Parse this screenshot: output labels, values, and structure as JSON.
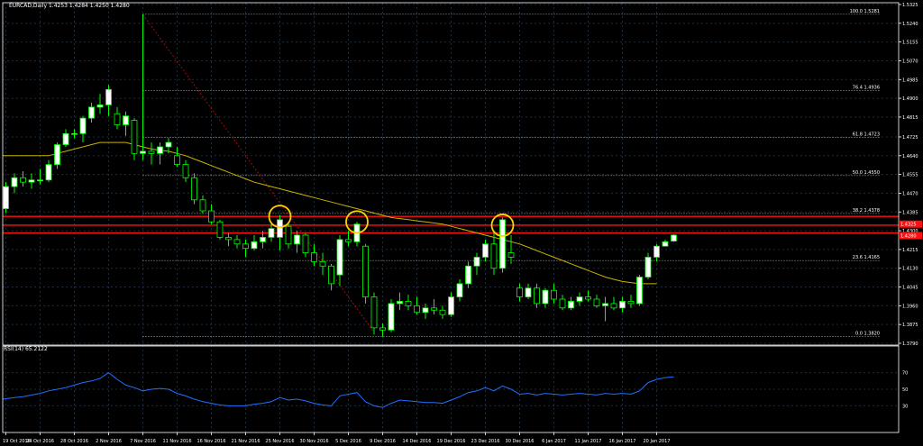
{
  "header": {
    "symbol_line": "EURCAD,Daily  1.4253 1.4284 1.4250 1.4280"
  },
  "rsi_label": "RSI(14) 65.2122",
  "colors": {
    "background": "#000000",
    "frame": "#ffffff",
    "grid": "#1e2c3a",
    "bull": "#00ff00",
    "bull_body": "#ffffff",
    "bear": "#00ff00",
    "bear_body": "#000000",
    "ma": "#c8b400",
    "fib": "#ffffff",
    "resistance": "#ff1010",
    "trend": "#c01010",
    "circle": "#ffd400",
    "rsi": "#2070ff",
    "price_tag": "#ff1010"
  },
  "chart_data": [
    {
      "type": "candlestick",
      "title": "EURCAD,Daily",
      "ylim": [
        1.379,
        1.5325
      ],
      "y_ticks": [
        "1.5325",
        "1.5240",
        "1.5155",
        "1.5070",
        "1.4985",
        "1.4900",
        "1.4815",
        "1.4725",
        "1.4640",
        "1.4555",
        "1.4470",
        "1.4385",
        "1.4300",
        "1.4215",
        "1.4130",
        "1.4045",
        "1.3960",
        "1.3875",
        "1.3790"
      ],
      "x_ticks": [
        {
          "i": 0,
          "label": "19 Oct 2016"
        },
        {
          "i": 4,
          "label": "24 Oct 2016"
        },
        {
          "i": 8,
          "label": "28 Oct 2016"
        },
        {
          "i": 12,
          "label": "2 Nov 2016"
        },
        {
          "i": 16,
          "label": "7 Nov 2016"
        },
        {
          "i": 20,
          "label": "11 Nov 2016"
        },
        {
          "i": 24,
          "label": "16 Nov 2016"
        },
        {
          "i": 28,
          "label": "21 Nov 2016"
        },
        {
          "i": 32,
          "label": "25 Nov 2016"
        },
        {
          "i": 36,
          "label": "30 Nov 2016"
        },
        {
          "i": 40,
          "label": "5 Dec 2016"
        },
        {
          "i": 44,
          "label": "9 Dec 2016"
        },
        {
          "i": 48,
          "label": "14 Dec 2016"
        },
        {
          "i": 52,
          "label": "19 Dec 2016"
        },
        {
          "i": 56,
          "label": "23 Dec 2016"
        },
        {
          "i": 60,
          "label": "30 Dec 2016"
        },
        {
          "i": 64,
          "label": "6 Jan 2017"
        },
        {
          "i": 68,
          "label": "11 Jan 2017"
        },
        {
          "i": 72,
          "label": "16 Jan 2017"
        },
        {
          "i": 76,
          "label": "20 Jan 2017"
        }
      ],
      "candles": [
        [
          1.44,
          1.452,
          1.438,
          1.45
        ],
        [
          1.45,
          1.456,
          1.447,
          1.454
        ],
        [
          1.454,
          1.457,
          1.45,
          1.452
        ],
        [
          1.452,
          1.456,
          1.449,
          1.453
        ],
        [
          1.453,
          1.458,
          1.451,
          1.453
        ],
        [
          1.453,
          1.462,
          1.452,
          1.46
        ],
        [
          1.46,
          1.47,
          1.458,
          1.469
        ],
        [
          1.469,
          1.476,
          1.468,
          1.474
        ],
        [
          1.474,
          1.476,
          1.472,
          1.474
        ],
        [
          1.474,
          1.482,
          1.47,
          1.481
        ],
        [
          1.481,
          1.488,
          1.479,
          1.486
        ],
        [
          1.486,
          1.492,
          1.483,
          1.487
        ],
        [
          1.487,
          1.496,
          1.482,
          1.494
        ],
        [
          1.483,
          1.486,
          1.476,
          1.478
        ],
        [
          1.478,
          1.484,
          1.473,
          1.482
        ],
        [
          1.48,
          1.481,
          1.462,
          1.465
        ],
        [
          1.465,
          1.528,
          1.462,
          1.466
        ],
        [
          1.466,
          1.47,
          1.46,
          1.465
        ],
        [
          1.465,
          1.47,
          1.46,
          1.468
        ],
        [
          1.468,
          1.472,
          1.465,
          1.47
        ],
        [
          1.464,
          1.468,
          1.459,
          1.46
        ],
        [
          1.46,
          1.462,
          1.452,
          1.454
        ],
        [
          1.454,
          1.456,
          1.442,
          1.444
        ],
        [
          1.444,
          1.446,
          1.438,
          1.439
        ],
        [
          1.439,
          1.442,
          1.433,
          1.434
        ],
        [
          1.434,
          1.435,
          1.426,
          1.427
        ],
        [
          1.427,
          1.429,
          1.423,
          1.426
        ],
        [
          1.426,
          1.428,
          1.422,
          1.424
        ],
        [
          1.424,
          1.426,
          1.418,
          1.422
        ],
        [
          1.422,
          1.428,
          1.421,
          1.425
        ],
        [
          1.425,
          1.43,
          1.422,
          1.427
        ],
        [
          1.427,
          1.433,
          1.425,
          1.431
        ],
        [
          1.427,
          1.437,
          1.421,
          1.435
        ],
        [
          1.432,
          1.434,
          1.422,
          1.424
        ],
        [
          1.424,
          1.43,
          1.42,
          1.428
        ],
        [
          1.428,
          1.429,
          1.418,
          1.42
        ],
        [
          1.42,
          1.424,
          1.414,
          1.416
        ],
        [
          1.416,
          1.42,
          1.41,
          1.414
        ],
        [
          1.414,
          1.415,
          1.403,
          1.406
        ],
        [
          1.41,
          1.428,
          1.405,
          1.426
        ],
        [
          1.426,
          1.43,
          1.423,
          1.425
        ],
        [
          1.425,
          1.434,
          1.423,
          1.433
        ],
        [
          1.423,
          1.424,
          1.397,
          1.4
        ],
        [
          1.4,
          1.402,
          1.383,
          1.386
        ],
        [
          1.386,
          1.388,
          1.382,
          1.385
        ],
        [
          1.385,
          1.399,
          1.384,
          1.397
        ],
        [
          1.397,
          1.402,
          1.394,
          1.398
        ],
        [
          1.398,
          1.401,
          1.394,
          1.396
        ],
        [
          1.396,
          1.4,
          1.392,
          1.393
        ],
        [
          1.393,
          1.397,
          1.39,
          1.395
        ],
        [
          1.395,
          1.399,
          1.392,
          1.394
        ],
        [
          1.394,
          1.396,
          1.39,
          1.392
        ],
        [
          1.392,
          1.402,
          1.391,
          1.4
        ],
        [
          1.4,
          1.408,
          1.398,
          1.406
        ],
        [
          1.406,
          1.416,
          1.404,
          1.414
        ],
        [
          1.414,
          1.42,
          1.41,
          1.418
        ],
        [
          1.418,
          1.426,
          1.416,
          1.424
        ],
        [
          1.424,
          1.43,
          1.41,
          1.413
        ],
        [
          1.413,
          1.436,
          1.411,
          1.435
        ],
        [
          1.42,
          1.428,
          1.415,
          1.418
        ],
        [
          1.404,
          1.406,
          1.398,
          1.4
        ],
        [
          1.4,
          1.406,
          1.399,
          1.404
        ],
        [
          1.404,
          1.406,
          1.395,
          1.397
        ],
        [
          1.397,
          1.404,
          1.395,
          1.403
        ],
        [
          1.403,
          1.406,
          1.397,
          1.399
        ],
        [
          1.399,
          1.401,
          1.394,
          1.395
        ],
        [
          1.395,
          1.4,
          1.394,
          1.398
        ],
        [
          1.398,
          1.402,
          1.396,
          1.4
        ],
        [
          1.4,
          1.403,
          1.398,
          1.399
        ],
        [
          1.399,
          1.401,
          1.395,
          1.396
        ],
        [
          1.396,
          1.4,
          1.389,
          1.397
        ],
        [
          1.397,
          1.4,
          1.394,
          1.395
        ],
        [
          1.395,
          1.4,
          1.393,
          1.398
        ],
        [
          1.398,
          1.401,
          1.395,
          1.397
        ],
        [
          1.397,
          1.41,
          1.396,
          1.409
        ],
        [
          1.409,
          1.42,
          1.408,
          1.418
        ],
        [
          1.418,
          1.424,
          1.416,
          1.423
        ],
        [
          1.423,
          1.426,
          1.423,
          1.425
        ],
        [
          1.4253,
          1.4284,
          1.425,
          1.428
        ]
      ],
      "ma_values": [
        1.464,
        1.464,
        1.464,
        1.464,
        1.464,
        1.464,
        1.465,
        1.466,
        1.467,
        1.468,
        1.469,
        1.47,
        1.47,
        1.47,
        1.47,
        1.469,
        1.468,
        1.467,
        1.4665,
        1.466,
        1.465,
        1.464,
        1.4625,
        1.461,
        1.4595,
        1.458,
        1.4565,
        1.455,
        1.4535,
        1.452,
        1.451,
        1.45,
        1.449,
        1.448,
        1.447,
        1.446,
        1.445,
        1.444,
        1.443,
        1.442,
        1.441,
        1.44,
        1.439,
        1.438,
        1.437,
        1.436,
        1.4355,
        1.435,
        1.4345,
        1.434,
        1.4335,
        1.433,
        1.432,
        1.431,
        1.43,
        1.429,
        1.428,
        1.427,
        1.426,
        1.425,
        1.424,
        1.4225,
        1.421,
        1.4195,
        1.418,
        1.4165,
        1.415,
        1.4135,
        1.412,
        1.4105,
        1.409,
        1.408,
        1.407,
        1.4065,
        1.406,
        1.406,
        1.406
      ],
      "fibonacci": [
        {
          "label": "100.0  1.5281",
          "value": 1.5281
        },
        {
          "label": "76.4  1.4936",
          "value": 1.4936
        },
        {
          "label": "61.8  1.4723",
          "value": 1.4723
        },
        {
          "label": "50.0  1.4550",
          "value": 1.455
        },
        {
          "label": "38.2  1.4378",
          "value": 1.4378
        },
        {
          "label": "23.6  1.4165",
          "value": 1.4165
        },
        {
          "label": "0.0  1.3820",
          "value": 1.382
        }
      ],
      "resistance_lines": [
        1.4365,
        1.4325,
        1.429
      ],
      "price_tags": [
        {
          "label": "1.4325",
          "value": 1.433
        },
        {
          "label": "1.4280",
          "value": 1.4278
        }
      ],
      "trend_line": {
        "from": {
          "i": 16,
          "price": 1.528
        },
        "to": {
          "i": 43,
          "price": 1.384
        }
      },
      "highlight_circles": [
        {
          "i": 32,
          "price": 1.4365
        },
        {
          "i": 41,
          "price": 1.434
        },
        {
          "i": 58,
          "price": 1.4325
        }
      ]
    },
    {
      "type": "line",
      "title": "RSI(14) 65.2122",
      "ylim": [
        0,
        100
      ],
      "y_ticks": [
        "70",
        "50",
        "30"
      ],
      "values": [
        38,
        40,
        41,
        43,
        45,
        48,
        50,
        52,
        55,
        58,
        60,
        63,
        70,
        62,
        55,
        52,
        48,
        50,
        51,
        50,
        45,
        42,
        38,
        35,
        33,
        31,
        30,
        30,
        30,
        32,
        33,
        35,
        40,
        37,
        38,
        36,
        33,
        31,
        30,
        42,
        44,
        46,
        35,
        30,
        28,
        33,
        37,
        36,
        35,
        34,
        34,
        33,
        37,
        41,
        46,
        48,
        52,
        48,
        54,
        50,
        44,
        45,
        43,
        45,
        44,
        43,
        44,
        45,
        44,
        43,
        45,
        44,
        45,
        44,
        48,
        58,
        62,
        64,
        65
      ]
    }
  ]
}
